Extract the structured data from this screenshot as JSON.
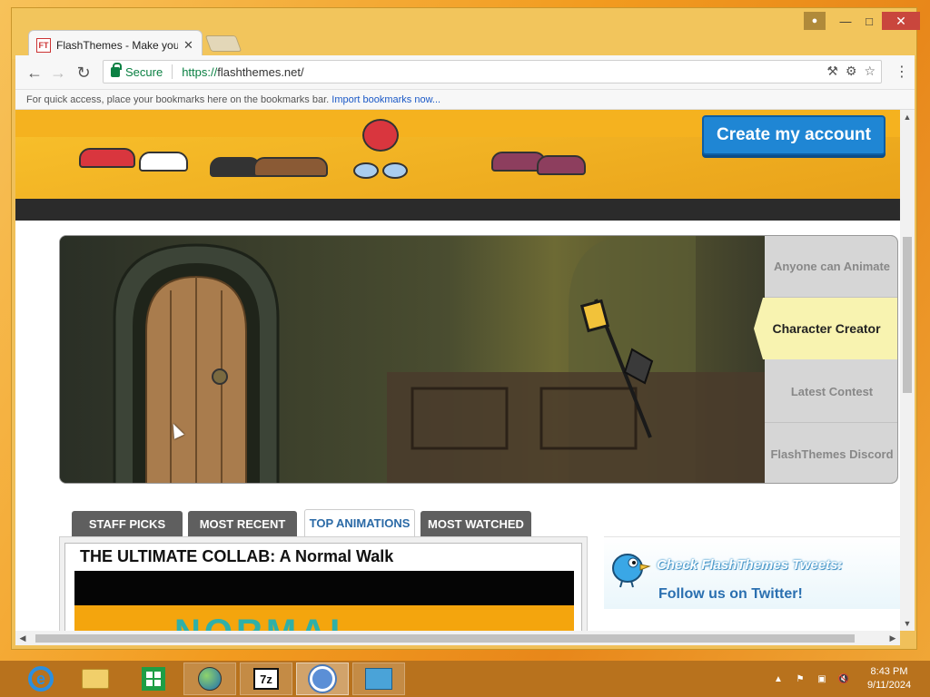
{
  "browser": {
    "tab_title": "FlashThemes - Make you",
    "tab_favicon": "FT",
    "secure_label": "Secure",
    "url_scheme": "https://",
    "url_host": "flashthemes.net/",
    "bookmarks_hint": "For quick access, place your bookmarks here on the bookmarks bar.",
    "bookmarks_import": "Import bookmarks now..."
  },
  "page": {
    "create_account": "Create my account",
    "slideshow_menu": [
      {
        "label": "Anyone can Animate",
        "active": false
      },
      {
        "label": "Character Creator",
        "active": true
      },
      {
        "label": "Latest Contest",
        "active": false
      },
      {
        "label": "FlashThemes Discord",
        "active": false
      }
    ],
    "content_tabs": [
      {
        "label": "STAFF PICKS",
        "active": false
      },
      {
        "label": "MOST RECENT",
        "active": false
      },
      {
        "label": "TOP ANIMATIONS",
        "active": true
      },
      {
        "label": "MOST WATCHED",
        "active": false
      }
    ],
    "featured_video_title": "THE ULTIMATE COLLAB: A Normal Walk",
    "featured_video_thumb_text": "NORMAL",
    "twitter_heading": "Check FlashThemes Tweets:",
    "twitter_follow": "Follow us on Twitter!"
  },
  "taskbar": {
    "items": [
      {
        "name": "internet-explorer",
        "label": "e"
      },
      {
        "name": "file-explorer",
        "label": ""
      },
      {
        "name": "store",
        "label": ""
      },
      {
        "name": "network-globe",
        "label": ""
      },
      {
        "name": "7-zip",
        "label": "7z"
      },
      {
        "name": "chrome",
        "label": ""
      },
      {
        "name": "remote-desktop",
        "label": ""
      }
    ],
    "clock_time": "8:43 PM",
    "clock_date": "9/11/2024"
  },
  "colors": {
    "accent_blue": "#1f86d4",
    "brand_orange": "#f5b21f",
    "active_menu": "#f8f3b0"
  }
}
